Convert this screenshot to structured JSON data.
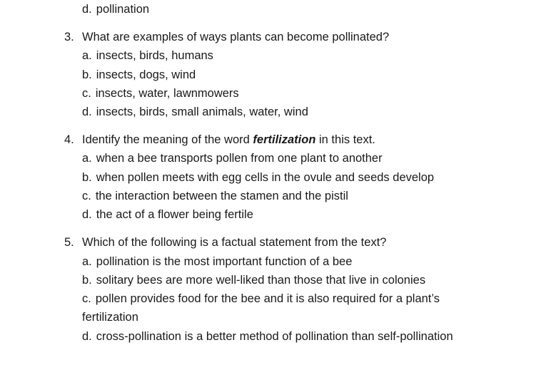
{
  "prev_option": {
    "letter": "d.",
    "text": "pollination"
  },
  "questions": [
    {
      "number": "3.",
      "text": "What are examples of ways plants can become pollinated?",
      "options": [
        {
          "letter": "a.",
          "text": "insects, birds, humans"
        },
        {
          "letter": "b.",
          "text": "insects, dogs, wind"
        },
        {
          "letter": "c.",
          "text": "insects, water, lawnmowers"
        },
        {
          "letter": "d.",
          "text": "insects, birds, small animals, water, wind"
        }
      ]
    },
    {
      "number": "4.",
      "text_before": "Identify the meaning of the word ",
      "keyword": "fertilization",
      "text_after": " in this text.",
      "options": [
        {
          "letter": "a.",
          "text": "when a bee transports pollen from one plant to another"
        },
        {
          "letter": "b.",
          "text": "when pollen meets with egg cells in the ovule and seeds develop"
        },
        {
          "letter": "c.",
          "text": "the interaction between the stamen and the pistil"
        },
        {
          "letter": "d.",
          "text": "the act of a flower being fertile"
        }
      ]
    },
    {
      "number": "5.",
      "text": "Which of the following is a factual statement from the text?",
      "options": [
        {
          "letter": "a.",
          "text": "pollination is the most important function of a bee"
        },
        {
          "letter": "b.",
          "text": "solitary bees are more well-liked than those that live in colonies"
        },
        {
          "letter": "c.",
          "text": "pollen provides food for the bee and it is also required for a plant’s",
          "text_cont": "fertilization"
        },
        {
          "letter": "d.",
          "text": "cross-pollination is a better method of pollination than self-pollination"
        }
      ]
    }
  ]
}
